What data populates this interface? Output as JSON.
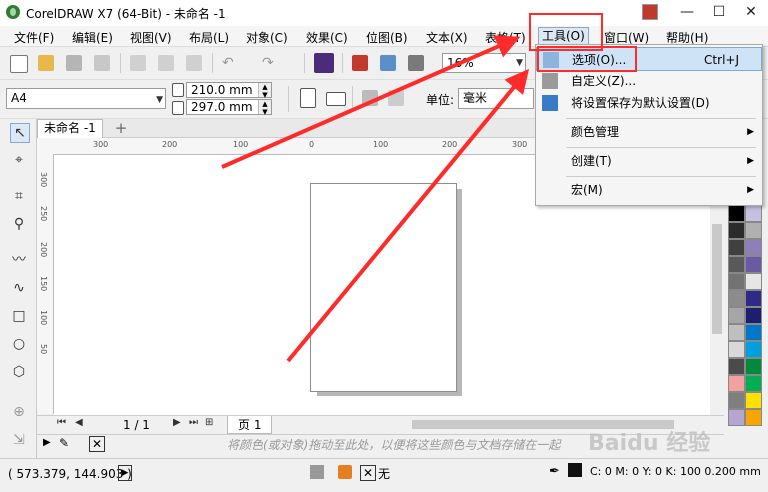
{
  "window": {
    "title": "CorelDRAW X7 (64-Bit) - 未命名 -1",
    "minimize": "—",
    "maximize": "☐",
    "close": "✕"
  },
  "menubar": [
    {
      "label": "文件(F)"
    },
    {
      "label": "编辑(E)"
    },
    {
      "label": "视图(V)"
    },
    {
      "label": "布局(L)"
    },
    {
      "label": "对象(C)"
    },
    {
      "label": "效果(C)"
    },
    {
      "label": "位图(B)"
    },
    {
      "label": "文本(X)"
    },
    {
      "label": "表格(T)"
    },
    {
      "label": "工具(O)"
    },
    {
      "label": "窗口(W)"
    },
    {
      "label": "帮助(H)"
    }
  ],
  "toolbar": {
    "zoom_value": "16%"
  },
  "propertybar": {
    "page_size": "A4",
    "width": "210.0 mm",
    "height": "297.0 mm",
    "units_label": "单位:",
    "units_value": "毫米"
  },
  "document": {
    "tab_label": "未命名 -1",
    "add_tab": "+"
  },
  "rulers": {
    "horizontal": [
      "300",
      "200",
      "100",
      "0",
      "100",
      "200",
      "300"
    ],
    "vertical": [
      "300",
      "250",
      "200",
      "150",
      "100",
      "50"
    ]
  },
  "page_nav": {
    "current": "1 / 1",
    "page_tab": "页 1"
  },
  "color_dock_hint": "将颜色(或对象)拖动至此处，以便将这些颜色与文档存储在一起",
  "statusbar": {
    "coords": "( 573.379, 144.903 )",
    "fill_none": "无",
    "outline": "C: 0 M: 0 Y: 0 K: 100  0.200 mm"
  },
  "tools_menu": {
    "items": [
      {
        "label": "选项(O)...",
        "shortcut": "Ctrl+J",
        "icon": "options-icon"
      },
      {
        "label": "自定义(Z)...",
        "shortcut": "",
        "icon": "customize-icon"
      },
      {
        "label": "将设置保存为默认设置(D)",
        "shortcut": "",
        "icon": "save-default-icon"
      },
      {
        "label": "颜色管理",
        "shortcut": "",
        "submenu": true
      },
      {
        "label": "创建(T)",
        "shortcut": "",
        "submenu": true
      },
      {
        "label": "宏(M)",
        "shortcut": "",
        "submenu": true
      }
    ]
  },
  "palette_colors": [
    "#ffffff",
    "#000000",
    "#2b2b2b",
    "#404040",
    "#595959",
    "#737373",
    "#8c8c8c",
    "#a6a6a6",
    "#bfbfbf",
    "#d9d9d9",
    "#4b4b4b",
    "#f2a1a1",
    "#7f7f7f",
    "#b3a6d1",
    "#9e9e9e",
    "#c7c1e0",
    "#b0b0b0",
    "#8f7fb8",
    "#6a5aa3",
    "#e6e6e6",
    "#2e2a87",
    "#1e1e6e",
    "#0077c8",
    "#00a0e0",
    "#008a3e",
    "#00b050",
    "#ffe000",
    "#f7a600"
  ],
  "watermark": "Baidu 经验",
  "accent_red": "#ff2a2a"
}
